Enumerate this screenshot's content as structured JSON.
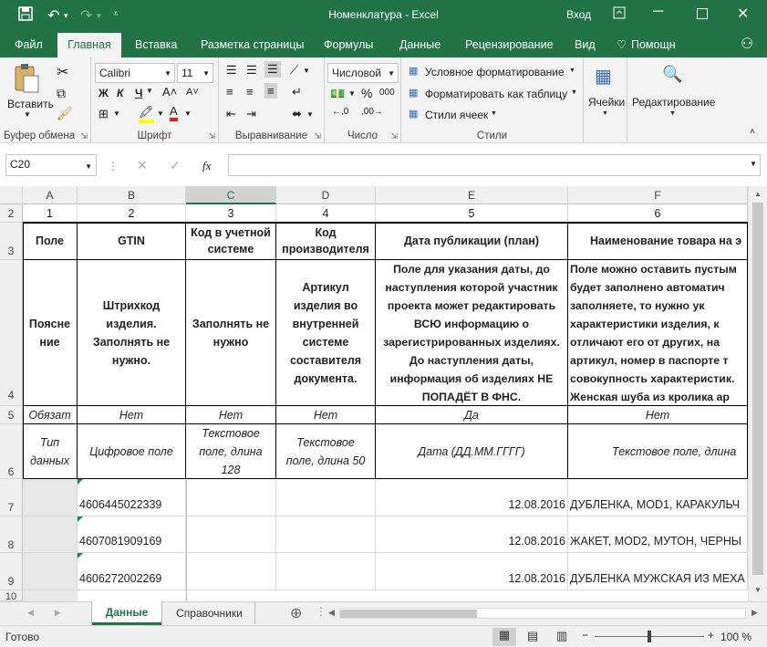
{
  "window": {
    "title": "Номенклатура - Excel",
    "login": "Вход"
  },
  "ribbon_tabs": [
    "Файл",
    "Главная",
    "Вставка",
    "Разметка страницы",
    "Формулы",
    "Данные",
    "Рецензирование",
    "Вид",
    "Помощн"
  ],
  "ribbon": {
    "paste": "Вставить",
    "clipboard": "Буфер обмена",
    "font_name": "Calibri",
    "font_size": "11",
    "font_group": "Шрифт",
    "align_group": "Выравнивание",
    "number_format": "Числовой",
    "number_group": "Число",
    "cond_format": "Условное форматирование",
    "format_table": "Форматировать как таблицу",
    "cell_styles": "Стили ячеек",
    "styles_group": "Стили",
    "cells": "Ячейки",
    "editing": "Редактирование",
    "bold": "Ж",
    "italic": "К",
    "underline": "Ч",
    "percent": "%",
    "thousands": "000"
  },
  "formula_bar": {
    "name_box": "C20",
    "fx": "fx",
    "value": ""
  },
  "columns": [
    "A",
    "B",
    "C",
    "D",
    "E",
    "F"
  ],
  "rows": {
    "r2": [
      "2",
      "1",
      "2",
      "3",
      "4",
      "5",
      "6"
    ],
    "r3": [
      "3",
      "Поле",
      "GTIN",
      "Код в учетной системе",
      "Код производителя",
      "Дата публикации (план)",
      "Наименование товара на э"
    ],
    "r4": {
      "num": "4",
      "a": "Поясне ние",
      "b": "Штрихкод изделия. Заполнять не нужно.",
      "c": "Заполнять не нужно",
      "d": "Артикул изделия во внутренней системе составителя документа.",
      "e": "Поле для указания даты, до наступления которой участник проекта может редактировать ВСЮ информацию о зарегистрированных изделиях. До наступления даты, информация об изделиях НЕ ПОПАДЁТ В ФНС.",
      "f": "Поле можно оставить пустым будет заполнено автоматич заполняете, то нужно ук характеристики изделия, к отличают его от других, на артикул, номер в паспорте т совокупность характеристик. Женская шуба из кролика ар"
    },
    "r5": [
      "5",
      "Обязат",
      "Нет",
      "Нет",
      "Нет",
      "Да",
      "Нет"
    ],
    "r6": [
      "6",
      "Тип данных",
      "Цифровое поле",
      "Текстовое поле, длина 128",
      "Текстовое поле, длина 50",
      "Дата (ДД.ММ.ГГГГ)",
      "Текстовое поле, длина"
    ],
    "data": [
      {
        "num": "7",
        "gtin": "4606445022339",
        "date": "12.08.2016",
        "name": "ДУБЛЕНКА, MOD1, КАРАКУЛЬЧ"
      },
      {
        "num": "8",
        "gtin": "4607081909169",
        "date": "12.08.2016",
        "name": "ЖАКЕТ, MOD2, МУТОН, ЧЕРНЫ"
      },
      {
        "num": "9",
        "gtin": "4606272002269",
        "date": "12.08.2016",
        "name": "ДУБЛЕНКА МУЖСКАЯ ИЗ МЕХА"
      }
    ],
    "r10": "10"
  },
  "sheets": [
    "Данные",
    "Справочники"
  ],
  "status": {
    "ready": "Готово",
    "zoom": "100 %"
  }
}
